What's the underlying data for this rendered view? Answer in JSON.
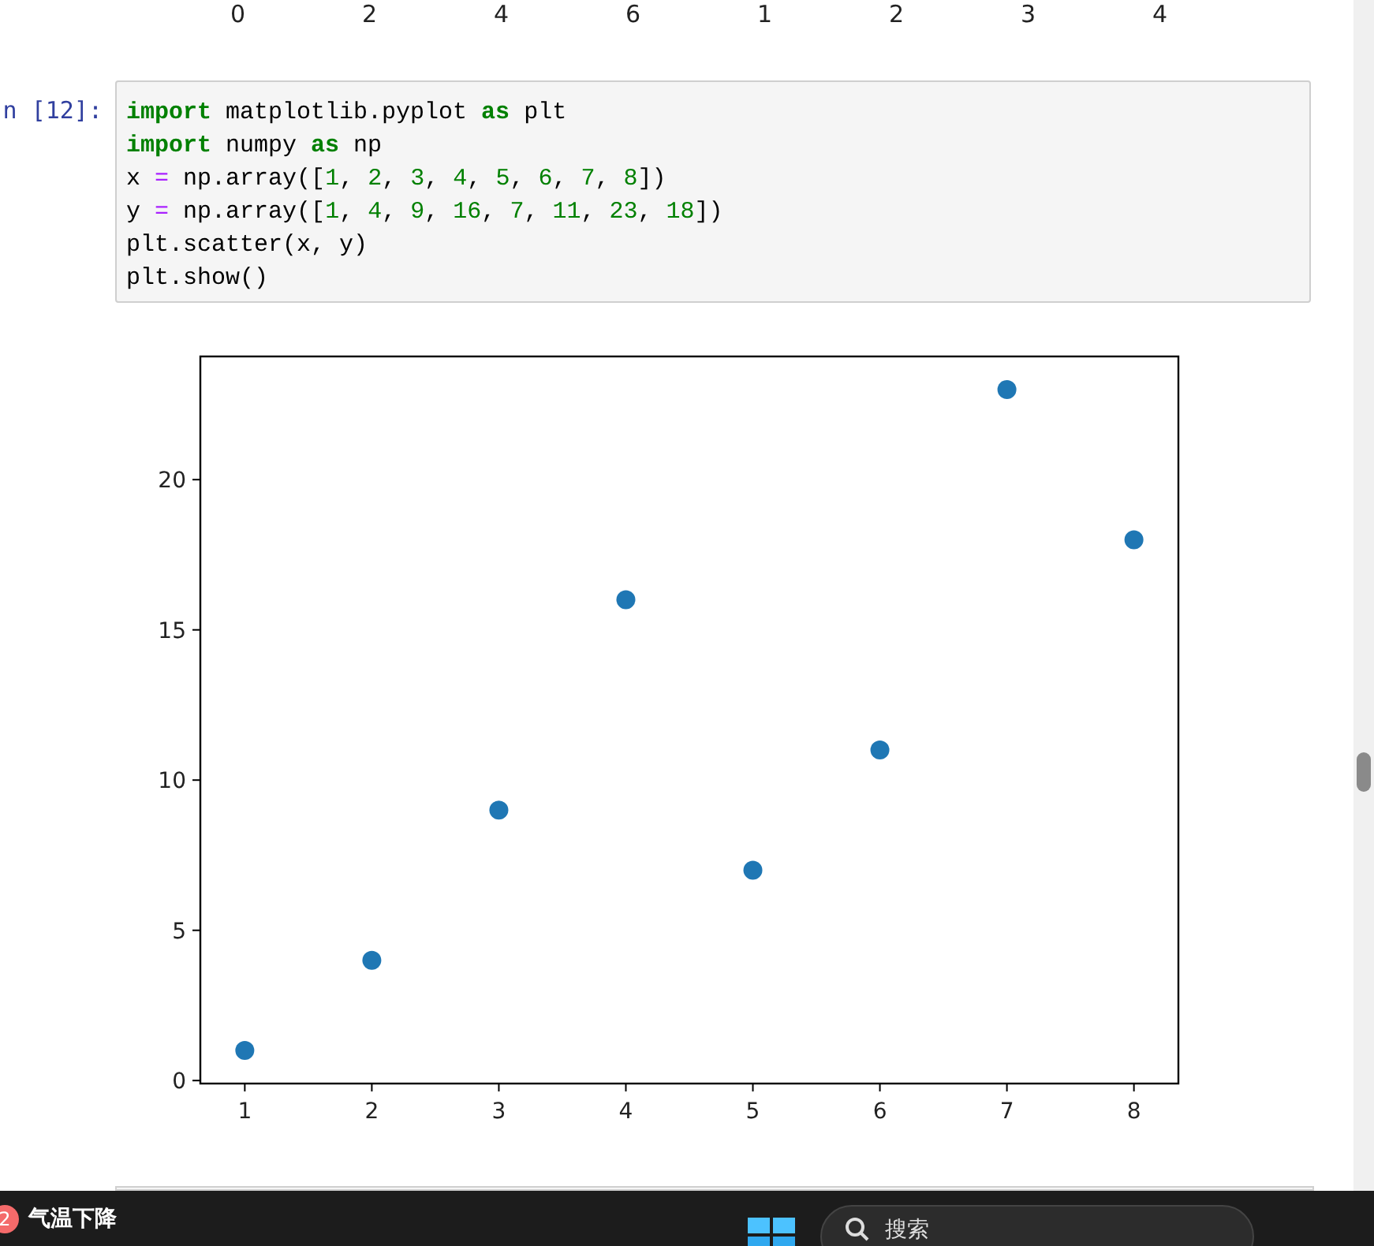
{
  "previous_output_ticks": [
    "0",
    "2",
    "4",
    "6",
    "1",
    "2",
    "3",
    "4"
  ],
  "cell": {
    "prompt": "n [12]:",
    "lines": [
      [
        {
          "text": "import",
          "kind": "keyword"
        },
        {
          "text": " matplotlib.pyplot ",
          "kind": "plain"
        },
        {
          "text": "as",
          "kind": "keyword"
        },
        {
          "text": " plt",
          "kind": "plain"
        }
      ],
      [
        {
          "text": "import",
          "kind": "keyword"
        },
        {
          "text": " numpy ",
          "kind": "plain"
        },
        {
          "text": "as",
          "kind": "keyword"
        },
        {
          "text": " np",
          "kind": "plain"
        }
      ],
      [
        {
          "text": "x ",
          "kind": "plain"
        },
        {
          "text": "=",
          "kind": "operator"
        },
        {
          "text": " np.array([",
          "kind": "plain"
        },
        {
          "text": "1",
          "kind": "number"
        },
        {
          "text": ", ",
          "kind": "plain"
        },
        {
          "text": "2",
          "kind": "number"
        },
        {
          "text": ", ",
          "kind": "plain"
        },
        {
          "text": "3",
          "kind": "number"
        },
        {
          "text": ", ",
          "kind": "plain"
        },
        {
          "text": "4",
          "kind": "number"
        },
        {
          "text": ", ",
          "kind": "plain"
        },
        {
          "text": "5",
          "kind": "number"
        },
        {
          "text": ", ",
          "kind": "plain"
        },
        {
          "text": "6",
          "kind": "number"
        },
        {
          "text": ", ",
          "kind": "plain"
        },
        {
          "text": "7",
          "kind": "number"
        },
        {
          "text": ", ",
          "kind": "plain"
        },
        {
          "text": "8",
          "kind": "number"
        },
        {
          "text": "])",
          "kind": "plain"
        }
      ],
      [
        {
          "text": "y ",
          "kind": "plain"
        },
        {
          "text": "=",
          "kind": "operator"
        },
        {
          "text": " np.array([",
          "kind": "plain"
        },
        {
          "text": "1",
          "kind": "number"
        },
        {
          "text": ", ",
          "kind": "plain"
        },
        {
          "text": "4",
          "kind": "number"
        },
        {
          "text": ", ",
          "kind": "plain"
        },
        {
          "text": "9",
          "kind": "number"
        },
        {
          "text": ", ",
          "kind": "plain"
        },
        {
          "text": "16",
          "kind": "number"
        },
        {
          "text": ", ",
          "kind": "plain"
        },
        {
          "text": "7",
          "kind": "number"
        },
        {
          "text": ", ",
          "kind": "plain"
        },
        {
          "text": "11",
          "kind": "number"
        },
        {
          "text": ", ",
          "kind": "plain"
        },
        {
          "text": "23",
          "kind": "number"
        },
        {
          "text": ", ",
          "kind": "plain"
        },
        {
          "text": "18",
          "kind": "number"
        },
        {
          "text": "])",
          "kind": "plain"
        }
      ],
      [
        {
          "text": "plt.scatter(x, y)",
          "kind": "plain"
        }
      ],
      [
        {
          "text": "plt.show()",
          "kind": "plain"
        }
      ]
    ]
  },
  "output": {
    "chart_data": {
      "type": "scatter",
      "x": [
        1,
        2,
        3,
        4,
        5,
        6,
        7,
        8
      ],
      "series": [
        {
          "color": "#1f77b4",
          "values": [
            1,
            4,
            9,
            16,
            7,
            11,
            23,
            18
          ]
        }
      ],
      "xlim": [
        0.65,
        8.35
      ],
      "ylim": [
        -0.1,
        24.1
      ],
      "xticks": [
        1,
        2,
        3,
        4,
        5,
        6,
        7,
        8
      ],
      "yticks": [
        0,
        5,
        10,
        15,
        20
      ]
    }
  },
  "taskbar": {
    "weather_badge": "2",
    "weather_text": "气温下降",
    "search_placeholder": "搜索"
  }
}
